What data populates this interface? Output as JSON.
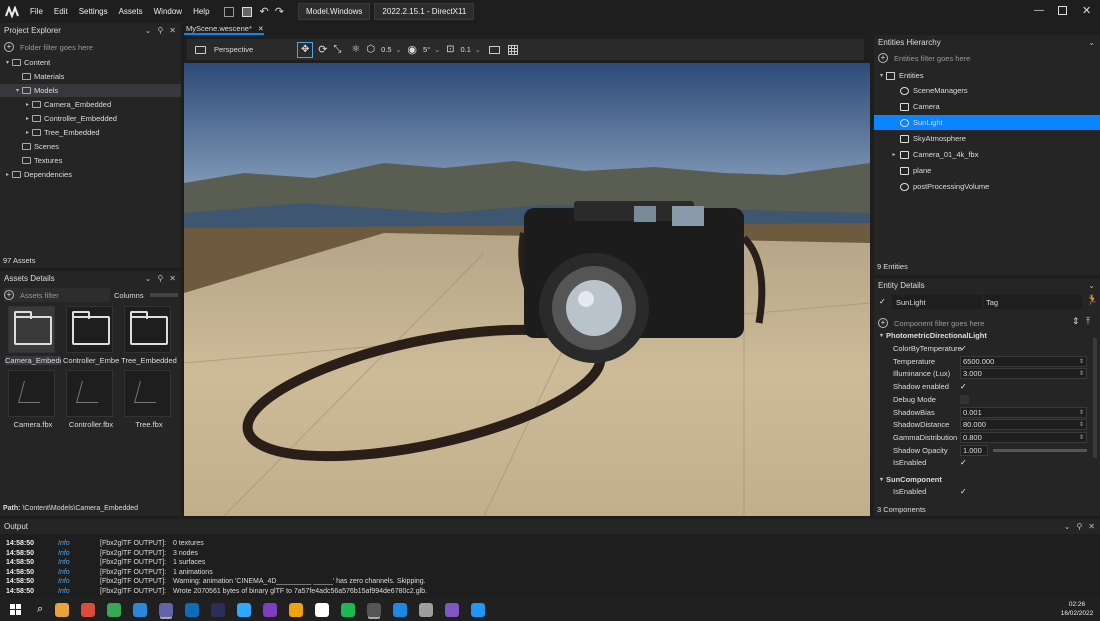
{
  "menubar": {
    "items": [
      "File",
      "Edit",
      "Settings",
      "Assets",
      "Window",
      "Help"
    ],
    "profile": "Model.Windows",
    "version": "2022.2.15.1 - DirectX11"
  },
  "project_explorer": {
    "title": "Project Explorer",
    "filter_placeholder": "Folder filter goes here",
    "tree": [
      {
        "label": "Content",
        "depth": 0,
        "arrow": "▾",
        "folder": true
      },
      {
        "label": "Materials",
        "depth": 1,
        "arrow": "",
        "folder": true
      },
      {
        "label": "Models",
        "depth": 1,
        "arrow": "▾",
        "folder": true,
        "selected": true
      },
      {
        "label": "Camera_Embedded",
        "depth": 2,
        "arrow": "▸",
        "folder": true
      },
      {
        "label": "Controller_Embedded",
        "depth": 2,
        "arrow": "▸",
        "folder": true
      },
      {
        "label": "Tree_Embedded",
        "depth": 2,
        "arrow": "▸",
        "folder": true
      },
      {
        "label": "Scenes",
        "depth": 1,
        "arrow": "",
        "folder": true
      },
      {
        "label": "Textures",
        "depth": 1,
        "arrow": "",
        "folder": true
      },
      {
        "label": "Dependencies",
        "depth": 0,
        "arrow": "▸",
        "folder": true
      }
    ],
    "count": "97 Assets"
  },
  "assets_details": {
    "title": "Assets Details",
    "filter_placeholder": "Assets filter",
    "columns_label": "Columns",
    "items": [
      {
        "label": "Camera_Embedded",
        "kind": "folder",
        "selected": true
      },
      {
        "label": "Controller_Embedded",
        "kind": "folder"
      },
      {
        "label": "Tree_Embedded",
        "kind": "folder"
      },
      {
        "label": "Camera.fbx",
        "kind": "model"
      },
      {
        "label": "Controller.fbx",
        "kind": "model"
      },
      {
        "label": "Tree.fbx",
        "kind": "model"
      }
    ],
    "path_label": "Path:",
    "path": "\\Content\\Models\\Camera_Embedded"
  },
  "scene_tab": {
    "label": "MyScene.wescene*",
    "close": "✕"
  },
  "viewport_toolbar": {
    "camera_mode": "Perspective",
    "scale_value": "0.5",
    "rotate_value": "5°",
    "snap_value": "0.1"
  },
  "entities": {
    "title": "Entities Hierarchy",
    "filter_placeholder": "Entities filter goes here",
    "root": "Entities",
    "items": [
      {
        "label": "SceneManagers",
        "icon": "gear-icon"
      },
      {
        "label": "Camera",
        "icon": "camera-icon"
      },
      {
        "label": "SunLight",
        "icon": "sun-icon",
        "selected": true
      },
      {
        "label": "SkyAtmosphere",
        "icon": "cloud-icon"
      },
      {
        "label": "Camera_01_4k_fbx",
        "icon": "cube-icon",
        "arrow": "▸"
      },
      {
        "label": "plane",
        "icon": "cube-icon"
      },
      {
        "label": "postProcessingVolume",
        "icon": "gear-icon"
      }
    ],
    "count": "9 Entities"
  },
  "entity_details": {
    "title": "Entity Details",
    "name": "SunLight",
    "tag_label": "Tag",
    "filter_placeholder": "Component filter goes here",
    "component1": "PhotometricDirectionalLight",
    "props1": [
      {
        "name": "ColorByTemperature",
        "kind": "check",
        "value": "✓"
      },
      {
        "name": "Temperature",
        "kind": "num",
        "value": "6500.000"
      },
      {
        "name": "Illuminance (Lux)",
        "kind": "num",
        "value": "3.000"
      },
      {
        "name": "Shadow enabled",
        "kind": "check",
        "value": "✓"
      },
      {
        "name": "Debug Mode",
        "kind": "check",
        "value": ""
      },
      {
        "name": "ShadowBias",
        "kind": "num",
        "value": "0.001"
      },
      {
        "name": "ShadowDistance",
        "kind": "num",
        "value": "80.000"
      },
      {
        "name": "GammaDistribution",
        "kind": "num",
        "value": "0.800"
      },
      {
        "name": "Shadow Opacity",
        "kind": "slider",
        "value": "1.000"
      },
      {
        "name": "IsEnabled",
        "kind": "check",
        "value": "✓"
      }
    ],
    "component2": "SunComponent",
    "props2": [
      {
        "name": "IsEnabled",
        "kind": "check",
        "value": "✓"
      }
    ],
    "count": "3 Components"
  },
  "output": {
    "title": "Output",
    "lines": [
      {
        "time": "14:58:50",
        "level": "Info",
        "src": "[Fbx2glTF OUTPUT]:",
        "msg": "0 textures"
      },
      {
        "time": "14:58:50",
        "level": "Info",
        "src": "[Fbx2glTF OUTPUT]:",
        "msg": "3 nodes"
      },
      {
        "time": "14:58:50",
        "level": "Info",
        "src": "[Fbx2glTF OUTPUT]:",
        "msg": "1 surfaces"
      },
      {
        "time": "14:58:50",
        "level": "Info",
        "src": "[Fbx2glTF OUTPUT]:",
        "msg": "1 animations"
      },
      {
        "time": "14:58:50",
        "level": "Info",
        "src": "[Fbx2glTF OUTPUT]:",
        "msg": "Warning: animation 'CINEMA_4D_________ _____' has zero channels. Skipping."
      },
      {
        "time": "14:58:50",
        "level": "Info",
        "src": "[Fbx2glTF OUTPUT]:",
        "msg": "Wrote 2070561 bytes of binary glTF to 7a57fe4adc56a576b15af994de6780c2.glb."
      }
    ]
  },
  "taskbar": {
    "time": "02:26",
    "date": "16/02/2022",
    "apps": [
      "#e8a33c",
      "#dd4b39",
      "#34a853",
      "#2b88d8",
      "#6264a7",
      "#0f6cbd",
      "#2d2d5a",
      "#31a8ff",
      "#7b3fbf",
      "#f0a30a",
      "#ffffff",
      "#1db954",
      "#555555",
      "#1e88e5",
      "#9e9e9e",
      "#7e57c2",
      "#2196f3"
    ]
  },
  "colors": {
    "accent": "#0a84ff",
    "info": "#4ea6e8"
  }
}
